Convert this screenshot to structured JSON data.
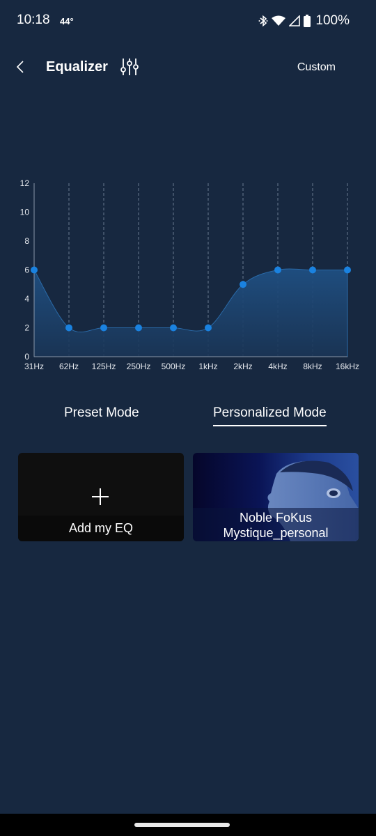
{
  "status_bar": {
    "time": "10:18",
    "temperature": "44°",
    "battery": "100%",
    "icons": [
      "bluetooth-icon",
      "wifi-icon",
      "signal-icon",
      "battery-icon"
    ]
  },
  "header": {
    "title": "Equalizer",
    "back_icon": "chevron-left-icon",
    "eq_icon": "sliders-icon",
    "preset_label": "Custom"
  },
  "chart_data": {
    "type": "area",
    "title": "",
    "xlabel": "",
    "ylabel": "",
    "categories": [
      "31Hz",
      "62Hz",
      "125Hz",
      "250Hz",
      "500Hz",
      "1kHz",
      "2kHz",
      "4kHz",
      "8kHz",
      "16kHz"
    ],
    "values": [
      6,
      2,
      2,
      2,
      2,
      2,
      5,
      6,
      6,
      6
    ],
    "ylim": [
      0,
      12
    ],
    "yticks": [
      0,
      2,
      4,
      6,
      8,
      10,
      12
    ],
    "grid": "vertical-dashed",
    "colors": {
      "point": "#1a82e0",
      "fill": "#1d4a78",
      "line": "#2a6aa8"
    }
  },
  "modes": {
    "preset": "Preset Mode",
    "personalized": "Personalized Mode",
    "active": "personalized"
  },
  "cards": {
    "add": {
      "label": "Add my EQ",
      "icon": "plus-icon"
    },
    "profile": {
      "line1": "Noble FoKus",
      "line2": "Mystique_personal"
    }
  }
}
